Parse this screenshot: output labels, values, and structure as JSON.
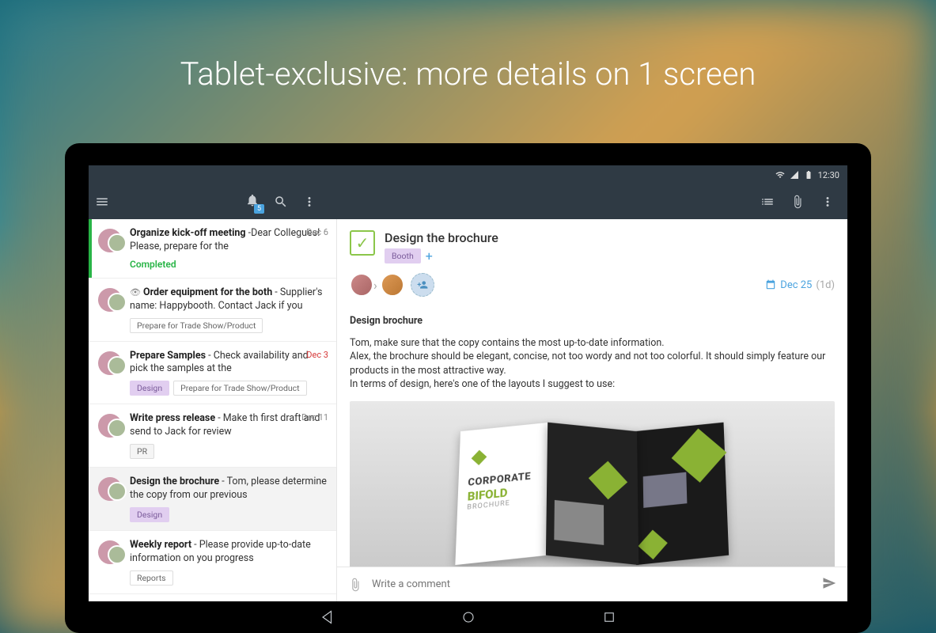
{
  "hero": "Tablet-exclusive:  more details on 1 screen",
  "statusbar": {
    "time": "12:30"
  },
  "notif_count": "5",
  "tasks": [
    {
      "title": "Organize kick-off meeting",
      "preview": " -Dear Collegues! Please, prepare for the",
      "date": "Dec 6",
      "status": "Completed",
      "completed": true
    },
    {
      "title": "Order equipment for the both",
      "preview": " - Supplier's name: Happybooth. Contact Jack if you",
      "watched": true,
      "tags": [
        "Prepare for Trade Show/Product"
      ]
    },
    {
      "title": "Prepare Samples",
      "preview": " - Check availability and pick the samples at the",
      "date": "Dec 3",
      "date_red": true,
      "tags": [
        "Design",
        "Prepare for Trade Show/Product"
      ]
    },
    {
      "title": "Write press release",
      "preview": " - Make th first draft and send to Jack for review",
      "date": "Dec 11",
      "tags": [
        "PR"
      ]
    },
    {
      "title": "Design the brochure",
      "preview": " - Tom, please determine the copy from our previous",
      "selected": true,
      "tags": [
        "Design"
      ]
    },
    {
      "title": "Weekly report",
      "preview": " - Please provide up-to-date information on you progress",
      "tags": [
        "Reports"
      ]
    }
  ],
  "detail": {
    "title": "Design the brochure",
    "tag": "Booth",
    "due_date": "Dec 25",
    "due_dur": "(1d)",
    "desc_title": "Design brochure",
    "desc_body": "Tom, make sure that the copy contains the most up-to-date information.\nAlex, the brochure should be elegant, concise, not too wordy and not too colorful. It should simply feature our products in the most attractive way.\nIn terms of design, here's one of the layouts I suggest to use:",
    "brochure": {
      "line1": "CORPORATE",
      "line2": "BIFOLD",
      "line3": "BROCHURE"
    }
  },
  "compose_placeholder": "Write a comment"
}
